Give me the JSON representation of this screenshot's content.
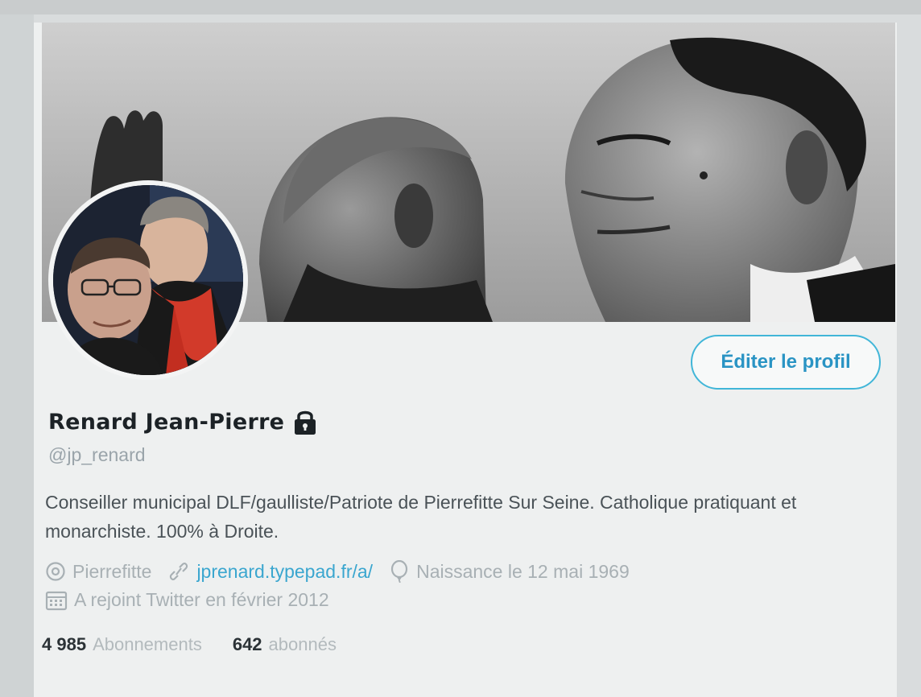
{
  "profile": {
    "display_name": "Renard Jean-Pierre",
    "handle": "@jp_renard",
    "bio": "Conseiller municipal DLF/gaulliste/Patriote de Pierrefitte Sur Seine. Catholique pratiquant et monarchiste. 100% à Droite.",
    "location": "Pierrefitte",
    "website": "jprenard.typepad.fr/a/",
    "birthday": "Naissance le 12 mai 1969",
    "joined": "A rejoint Twitter en février 2012",
    "protected_icon": "lock-icon"
  },
  "actions": {
    "edit_profile_label": "Éditer le profil"
  },
  "stats": {
    "following_count": "4 985",
    "following_label": "Abonnements",
    "followers_count": "642",
    "followers_label": "abonnés"
  },
  "icons": {
    "location": "location-pin-icon",
    "website": "link-icon",
    "birthday": "balloon-icon",
    "joined": "calendar-icon"
  },
  "colors": {
    "accent": "#41b6d8",
    "link": "#3aa6cf",
    "name": "#1c2226",
    "muted": "#a8b0b4"
  }
}
